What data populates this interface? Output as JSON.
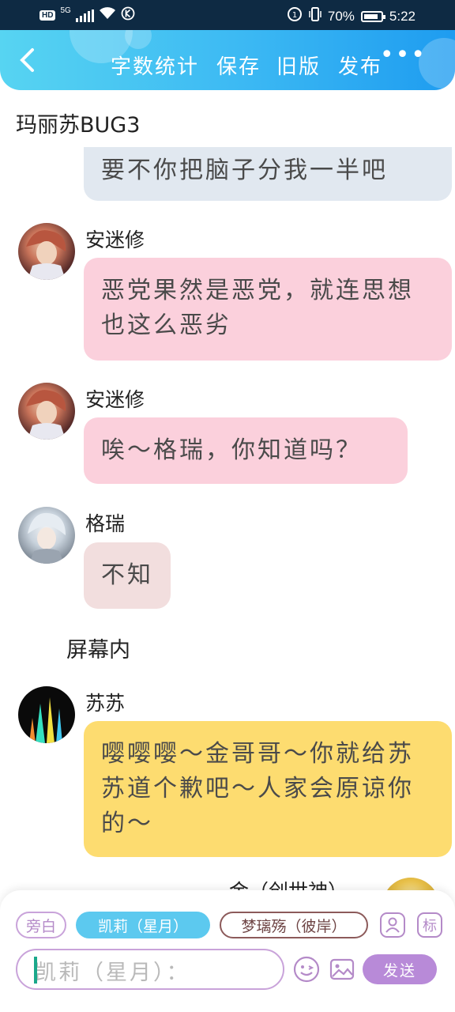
{
  "status_bar": {
    "hd": "HD",
    "network": "5G",
    "battery": "70%",
    "time": "5:22"
  },
  "header": {
    "back_icon": "chevron-left-icon",
    "actions": [
      "字数统计",
      "保存",
      "旧版",
      "发布"
    ],
    "more_icon": "more-icon"
  },
  "chat": {
    "narration_top": "玛丽苏BUG3",
    "partial_bubble": "要不你把脑子分我一半吧",
    "messages": [
      {
        "name": "安迷修",
        "text": "恶党果然是恶党，就连思想也这么恶劣"
      },
      {
        "name": "安迷修",
        "text": "唉～格瑞，你知道吗？"
      },
      {
        "name": "格瑞",
        "text": "不知"
      },
      {
        "name": "苏苏",
        "text": "嘤嘤嘤～金哥哥～你就给苏苏道个歉吧～人家会原谅你的～"
      }
    ],
    "narration_mid": "屏幕内",
    "partial_name": "金（创世神）"
  },
  "bottom": {
    "chips": [
      "旁白",
      "凯莉（星月）",
      "梦璃殇（彼岸）"
    ],
    "icon_buttons": [
      "person-icon",
      "标"
    ],
    "input_placeholder": "凯莉（星月）：",
    "send": "发送"
  },
  "colors": {
    "header_start": "#57d4f2",
    "header_end": "#1e9cf0",
    "pink_bubble": "#fbd0dc",
    "grey_bubble": "#e1e8f0",
    "pale_bubble": "#f2dede",
    "yellow_bubble": "#fddc70",
    "accent_purple": "#b88ad8"
  }
}
